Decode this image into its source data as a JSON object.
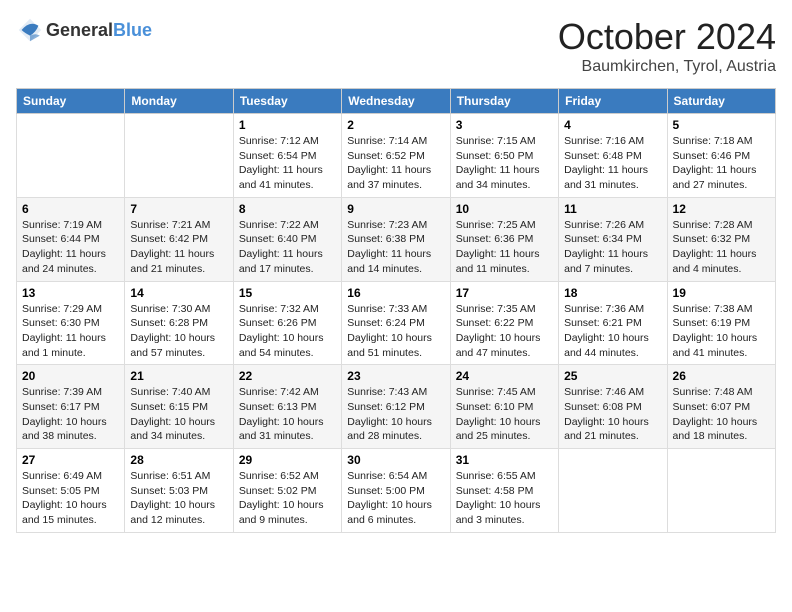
{
  "header": {
    "logo_general": "General",
    "logo_blue": "Blue",
    "month_title": "October 2024",
    "location": "Baumkirchen, Tyrol, Austria"
  },
  "weekdays": [
    "Sunday",
    "Monday",
    "Tuesday",
    "Wednesday",
    "Thursday",
    "Friday",
    "Saturday"
  ],
  "weeks": [
    [
      {
        "day": "",
        "info": ""
      },
      {
        "day": "",
        "info": ""
      },
      {
        "day": "1",
        "info": "Sunrise: 7:12 AM\nSunset: 6:54 PM\nDaylight: 11 hours and 41 minutes."
      },
      {
        "day": "2",
        "info": "Sunrise: 7:14 AM\nSunset: 6:52 PM\nDaylight: 11 hours and 37 minutes."
      },
      {
        "day": "3",
        "info": "Sunrise: 7:15 AM\nSunset: 6:50 PM\nDaylight: 11 hours and 34 minutes."
      },
      {
        "day": "4",
        "info": "Sunrise: 7:16 AM\nSunset: 6:48 PM\nDaylight: 11 hours and 31 minutes."
      },
      {
        "day": "5",
        "info": "Sunrise: 7:18 AM\nSunset: 6:46 PM\nDaylight: 11 hours and 27 minutes."
      }
    ],
    [
      {
        "day": "6",
        "info": "Sunrise: 7:19 AM\nSunset: 6:44 PM\nDaylight: 11 hours and 24 minutes."
      },
      {
        "day": "7",
        "info": "Sunrise: 7:21 AM\nSunset: 6:42 PM\nDaylight: 11 hours and 21 minutes."
      },
      {
        "day": "8",
        "info": "Sunrise: 7:22 AM\nSunset: 6:40 PM\nDaylight: 11 hours and 17 minutes."
      },
      {
        "day": "9",
        "info": "Sunrise: 7:23 AM\nSunset: 6:38 PM\nDaylight: 11 hours and 14 minutes."
      },
      {
        "day": "10",
        "info": "Sunrise: 7:25 AM\nSunset: 6:36 PM\nDaylight: 11 hours and 11 minutes."
      },
      {
        "day": "11",
        "info": "Sunrise: 7:26 AM\nSunset: 6:34 PM\nDaylight: 11 hours and 7 minutes."
      },
      {
        "day": "12",
        "info": "Sunrise: 7:28 AM\nSunset: 6:32 PM\nDaylight: 11 hours and 4 minutes."
      }
    ],
    [
      {
        "day": "13",
        "info": "Sunrise: 7:29 AM\nSunset: 6:30 PM\nDaylight: 11 hours and 1 minute."
      },
      {
        "day": "14",
        "info": "Sunrise: 7:30 AM\nSunset: 6:28 PM\nDaylight: 10 hours and 57 minutes."
      },
      {
        "day": "15",
        "info": "Sunrise: 7:32 AM\nSunset: 6:26 PM\nDaylight: 10 hours and 54 minutes."
      },
      {
        "day": "16",
        "info": "Sunrise: 7:33 AM\nSunset: 6:24 PM\nDaylight: 10 hours and 51 minutes."
      },
      {
        "day": "17",
        "info": "Sunrise: 7:35 AM\nSunset: 6:22 PM\nDaylight: 10 hours and 47 minutes."
      },
      {
        "day": "18",
        "info": "Sunrise: 7:36 AM\nSunset: 6:21 PM\nDaylight: 10 hours and 44 minutes."
      },
      {
        "day": "19",
        "info": "Sunrise: 7:38 AM\nSunset: 6:19 PM\nDaylight: 10 hours and 41 minutes."
      }
    ],
    [
      {
        "day": "20",
        "info": "Sunrise: 7:39 AM\nSunset: 6:17 PM\nDaylight: 10 hours and 38 minutes."
      },
      {
        "day": "21",
        "info": "Sunrise: 7:40 AM\nSunset: 6:15 PM\nDaylight: 10 hours and 34 minutes."
      },
      {
        "day": "22",
        "info": "Sunrise: 7:42 AM\nSunset: 6:13 PM\nDaylight: 10 hours and 31 minutes."
      },
      {
        "day": "23",
        "info": "Sunrise: 7:43 AM\nSunset: 6:12 PM\nDaylight: 10 hours and 28 minutes."
      },
      {
        "day": "24",
        "info": "Sunrise: 7:45 AM\nSunset: 6:10 PM\nDaylight: 10 hours and 25 minutes."
      },
      {
        "day": "25",
        "info": "Sunrise: 7:46 AM\nSunset: 6:08 PM\nDaylight: 10 hours and 21 minutes."
      },
      {
        "day": "26",
        "info": "Sunrise: 7:48 AM\nSunset: 6:07 PM\nDaylight: 10 hours and 18 minutes."
      }
    ],
    [
      {
        "day": "27",
        "info": "Sunrise: 6:49 AM\nSunset: 5:05 PM\nDaylight: 10 hours and 15 minutes."
      },
      {
        "day": "28",
        "info": "Sunrise: 6:51 AM\nSunset: 5:03 PM\nDaylight: 10 hours and 12 minutes."
      },
      {
        "day": "29",
        "info": "Sunrise: 6:52 AM\nSunset: 5:02 PM\nDaylight: 10 hours and 9 minutes."
      },
      {
        "day": "30",
        "info": "Sunrise: 6:54 AM\nSunset: 5:00 PM\nDaylight: 10 hours and 6 minutes."
      },
      {
        "day": "31",
        "info": "Sunrise: 6:55 AM\nSunset: 4:58 PM\nDaylight: 10 hours and 3 minutes."
      },
      {
        "day": "",
        "info": ""
      },
      {
        "day": "",
        "info": ""
      }
    ]
  ]
}
